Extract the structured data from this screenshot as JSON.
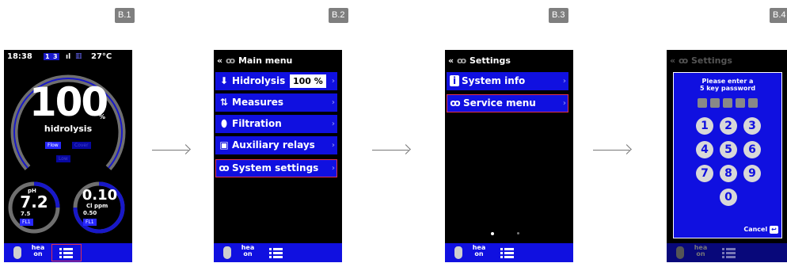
{
  "steps": [
    "B.1",
    "B.2",
    "B.3",
    "B.4"
  ],
  "screen1": {
    "time": "18:38",
    "badge1": "1",
    "badge2": "3",
    "temperature": "27°C",
    "main_value": "100",
    "main_unit": "%",
    "main_label": "hidrolysis",
    "flow_label": "Flow",
    "cover_label": "Cover",
    "low_label": "Low",
    "ph_title": "pH",
    "ph_value": "7.2",
    "ph_setpoint": "7.5",
    "ph_fl": "FL1",
    "cl_value": "0.10",
    "cl_unit": "Cl ppm",
    "cl_setpoint": "0.50",
    "cl_fl": "FL1"
  },
  "screen2": {
    "title": "Main menu",
    "items": [
      {
        "label": "Hidrolysis",
        "value": "100 %"
      },
      {
        "label": "Measures"
      },
      {
        "label": "Filtration"
      },
      {
        "label": "Auxiliary relays"
      },
      {
        "label": "System settings"
      }
    ]
  },
  "screen3": {
    "title": "Settings",
    "items": [
      {
        "label": "System info"
      },
      {
        "label": "Service menu"
      }
    ]
  },
  "screen4": {
    "title": "Settings",
    "prompt_line1": "Please enter a",
    "prompt_line2": "5 key password",
    "keys": [
      "1",
      "2",
      "3",
      "4",
      "5",
      "6",
      "7",
      "8",
      "9",
      "0"
    ],
    "cancel_label": "Cancel"
  },
  "bottom_bar": {
    "hea_line1": "hea",
    "hea_line2": "on"
  },
  "colors": {
    "accent_blue": "#1010e0",
    "highlight": "#e03050",
    "screen_bg": "#000000"
  }
}
